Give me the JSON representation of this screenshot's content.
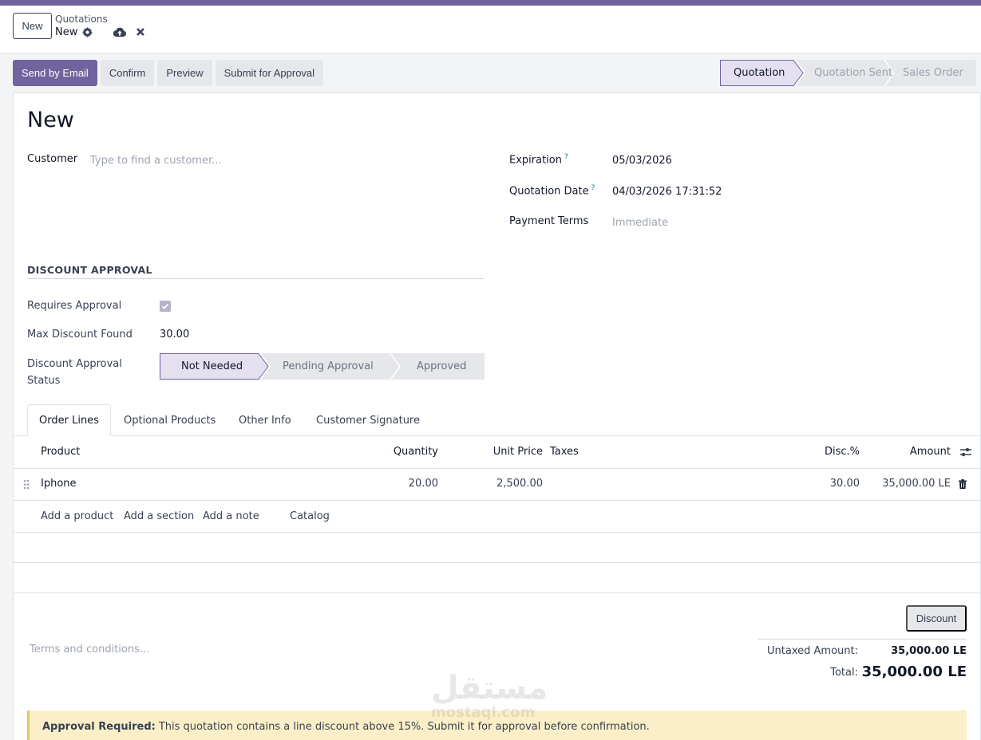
{
  "colors": {
    "accent": "#71639e",
    "stage_active": "#e4e0ef",
    "stage_inactive": "#e5e7eb"
  },
  "control_panel": {
    "new_button": "New",
    "breadcrumb_parent": "Quotations",
    "breadcrumb_current": "New",
    "icons": [
      "gear-icon",
      "cloud-upload-icon",
      "discard-icon"
    ]
  },
  "actions": {
    "send_by_email": "Send by Email",
    "confirm": "Confirm",
    "preview": "Preview",
    "submit_for_approval": "Submit for Approval"
  },
  "status_stages": [
    "Quotation",
    "Quotation Sent",
    "Sales Order"
  ],
  "status_active": "Quotation",
  "form": {
    "title": "New",
    "customer_label": "Customer",
    "customer_placeholder": "Type to find a customer...",
    "expiration_label": "Expiration",
    "expiration_value": "05/03/2026",
    "quotation_date_label": "Quotation Date",
    "quotation_date_value": "04/03/2026 17:31:52",
    "payment_terms_label": "Payment Terms",
    "payment_terms_placeholder": "Immediate",
    "help_marker": "?"
  },
  "discount_approval": {
    "section_title": "DISCOUNT APPROVAL",
    "requires_approval_label": "Requires Approval",
    "requires_approval_checked": true,
    "max_discount_label": "Max Discount Found",
    "max_discount_value": "30.00",
    "status_label_line1": "Discount Approval",
    "status_label_line2": "Status",
    "stages": [
      "Not Needed",
      "Pending Approval",
      "Approved"
    ],
    "active_stage": "Not Needed"
  },
  "tabs": [
    "Order Lines",
    "Optional Products",
    "Other Info",
    "Customer Signature"
  ],
  "active_tab": "Order Lines",
  "table": {
    "headers": {
      "product": "Product",
      "quantity": "Quantity",
      "unit_price": "Unit Price",
      "taxes": "Taxes",
      "disc": "Disc.%",
      "amount": "Amount"
    },
    "rows": [
      {
        "product": "Iphone",
        "quantity": "20.00",
        "unit_price": "2,500.00",
        "taxes": "",
        "disc": "30.00",
        "amount": "35,000.00 LE"
      }
    ],
    "add_links": {
      "add_product": "Add a product",
      "add_section": "Add a section",
      "add_note": "Add a note",
      "catalog": "Catalog"
    }
  },
  "footer": {
    "discount_button": "Discount",
    "terms_placeholder": "Terms and conditions...",
    "untaxed_label": "Untaxed Amount:",
    "untaxed_value": "35,000.00 LE",
    "total_label": "Total:",
    "total_value": "35,000.00 LE"
  },
  "alert": {
    "title": "Approval Required:",
    "message": "This quotation contains a line discount above 15%. Submit it for approval before confirmation."
  },
  "watermark": {
    "arabic": "مستقل",
    "latin": "mostaql.com"
  }
}
